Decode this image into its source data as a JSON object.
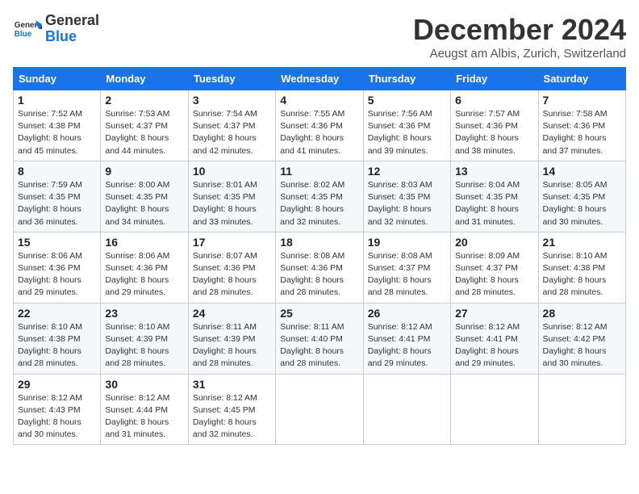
{
  "logo": {
    "general": "General",
    "blue": "Blue"
  },
  "header": {
    "title": "December 2024",
    "subtitle": "Aeugst am Albis, Zurich, Switzerland"
  },
  "calendar": {
    "days_of_week": [
      "Sunday",
      "Monday",
      "Tuesday",
      "Wednesday",
      "Thursday",
      "Friday",
      "Saturday"
    ],
    "weeks": [
      [
        {
          "day": "1",
          "sunrise": "7:52 AM",
          "sunset": "4:38 PM",
          "daylight": "8 hours and 45 minutes."
        },
        {
          "day": "2",
          "sunrise": "7:53 AM",
          "sunset": "4:37 PM",
          "daylight": "8 hours and 44 minutes."
        },
        {
          "day": "3",
          "sunrise": "7:54 AM",
          "sunset": "4:37 PM",
          "daylight": "8 hours and 42 minutes."
        },
        {
          "day": "4",
          "sunrise": "7:55 AM",
          "sunset": "4:36 PM",
          "daylight": "8 hours and 41 minutes."
        },
        {
          "day": "5",
          "sunrise": "7:56 AM",
          "sunset": "4:36 PM",
          "daylight": "8 hours and 39 minutes."
        },
        {
          "day": "6",
          "sunrise": "7:57 AM",
          "sunset": "4:36 PM",
          "daylight": "8 hours and 38 minutes."
        },
        {
          "day": "7",
          "sunrise": "7:58 AM",
          "sunset": "4:36 PM",
          "daylight": "8 hours and 37 minutes."
        }
      ],
      [
        {
          "day": "8",
          "sunrise": "7:59 AM",
          "sunset": "4:35 PM",
          "daylight": "8 hours and 36 minutes."
        },
        {
          "day": "9",
          "sunrise": "8:00 AM",
          "sunset": "4:35 PM",
          "daylight": "8 hours and 34 minutes."
        },
        {
          "day": "10",
          "sunrise": "8:01 AM",
          "sunset": "4:35 PM",
          "daylight": "8 hours and 33 minutes."
        },
        {
          "day": "11",
          "sunrise": "8:02 AM",
          "sunset": "4:35 PM",
          "daylight": "8 hours and 32 minutes."
        },
        {
          "day": "12",
          "sunrise": "8:03 AM",
          "sunset": "4:35 PM",
          "daylight": "8 hours and 32 minutes."
        },
        {
          "day": "13",
          "sunrise": "8:04 AM",
          "sunset": "4:35 PM",
          "daylight": "8 hours and 31 minutes."
        },
        {
          "day": "14",
          "sunrise": "8:05 AM",
          "sunset": "4:35 PM",
          "daylight": "8 hours and 30 minutes."
        }
      ],
      [
        {
          "day": "15",
          "sunrise": "8:06 AM",
          "sunset": "4:36 PM",
          "daylight": "8 hours and 29 minutes."
        },
        {
          "day": "16",
          "sunrise": "8:06 AM",
          "sunset": "4:36 PM",
          "daylight": "8 hours and 29 minutes."
        },
        {
          "day": "17",
          "sunrise": "8:07 AM",
          "sunset": "4:36 PM",
          "daylight": "8 hours and 28 minutes."
        },
        {
          "day": "18",
          "sunrise": "8:08 AM",
          "sunset": "4:36 PM",
          "daylight": "8 hours and 28 minutes."
        },
        {
          "day": "19",
          "sunrise": "8:08 AM",
          "sunset": "4:37 PM",
          "daylight": "8 hours and 28 minutes."
        },
        {
          "day": "20",
          "sunrise": "8:09 AM",
          "sunset": "4:37 PM",
          "daylight": "8 hours and 28 minutes."
        },
        {
          "day": "21",
          "sunrise": "8:10 AM",
          "sunset": "4:38 PM",
          "daylight": "8 hours and 28 minutes."
        }
      ],
      [
        {
          "day": "22",
          "sunrise": "8:10 AM",
          "sunset": "4:38 PM",
          "daylight": "8 hours and 28 minutes."
        },
        {
          "day": "23",
          "sunrise": "8:10 AM",
          "sunset": "4:39 PM",
          "daylight": "8 hours and 28 minutes."
        },
        {
          "day": "24",
          "sunrise": "8:11 AM",
          "sunset": "4:39 PM",
          "daylight": "8 hours and 28 minutes."
        },
        {
          "day": "25",
          "sunrise": "8:11 AM",
          "sunset": "4:40 PM",
          "daylight": "8 hours and 28 minutes."
        },
        {
          "day": "26",
          "sunrise": "8:12 AM",
          "sunset": "4:41 PM",
          "daylight": "8 hours and 29 minutes."
        },
        {
          "day": "27",
          "sunrise": "8:12 AM",
          "sunset": "4:41 PM",
          "daylight": "8 hours and 29 minutes."
        },
        {
          "day": "28",
          "sunrise": "8:12 AM",
          "sunset": "4:42 PM",
          "daylight": "8 hours and 30 minutes."
        }
      ],
      [
        {
          "day": "29",
          "sunrise": "8:12 AM",
          "sunset": "4:43 PM",
          "daylight": "8 hours and 30 minutes."
        },
        {
          "day": "30",
          "sunrise": "8:12 AM",
          "sunset": "4:44 PM",
          "daylight": "8 hours and 31 minutes."
        },
        {
          "day": "31",
          "sunrise": "8:12 AM",
          "sunset": "4:45 PM",
          "daylight": "8 hours and 32 minutes."
        },
        null,
        null,
        null,
        null
      ]
    ]
  }
}
